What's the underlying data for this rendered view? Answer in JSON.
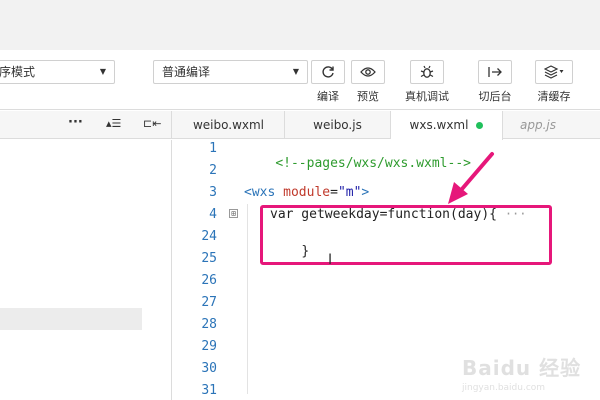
{
  "toolbar": {
    "mode_select": {
      "value": "序模式"
    },
    "compile_select": {
      "value": "普通编译"
    },
    "tools": [
      {
        "icon": "refresh-icon",
        "label": "编译"
      },
      {
        "icon": "eye-icon",
        "label": "预览"
      },
      {
        "icon": "bug-icon",
        "label": "真机调试"
      },
      {
        "icon": "switch-background-icon",
        "label": "切后台"
      },
      {
        "icon": "layers-icon",
        "label": "清缓存"
      }
    ]
  },
  "tabs": [
    {
      "label": "weibo.wxml",
      "active": false
    },
    {
      "label": "weibo.js",
      "active": false
    },
    {
      "label": "wxs.wxml",
      "active": true,
      "modified": true
    },
    {
      "label": "app.js",
      "active": false,
      "italic": true
    }
  ],
  "side_icons": [
    "more-icon",
    "collapse-list-icon",
    "split-left-icon"
  ],
  "side_icon_glyphs": [
    "···",
    "▴☰",
    "⊏⇤"
  ],
  "editor": {
    "line_numbers": [
      "1",
      "2",
      "3",
      "4",
      "24",
      "25",
      "26",
      "27",
      "28",
      "29",
      "30",
      "31"
    ],
    "lines": {
      "l1": "<!--pages/wxs/wxs.wxml-->",
      "l3_open": "<wxs ",
      "l3_attr": "module",
      "l3_eq": "=",
      "l3_val": "\"m\"",
      "l3_close": ">",
      "l4": "var getweekday=function(day){",
      "l4_ellipsis": "···",
      "l24": "}"
    },
    "fold_marker": "⊞"
  },
  "watermark": {
    "logo": "Baidu 经验",
    "sub": "jingyan.baidu.com"
  },
  "colors": {
    "annotation": "#e6177a",
    "line_number": "#2b74b8",
    "comment": "#2e9b2e",
    "tag": "#2b74b8",
    "attr": "#c0392b",
    "modified_dot": "#20c05c"
  }
}
